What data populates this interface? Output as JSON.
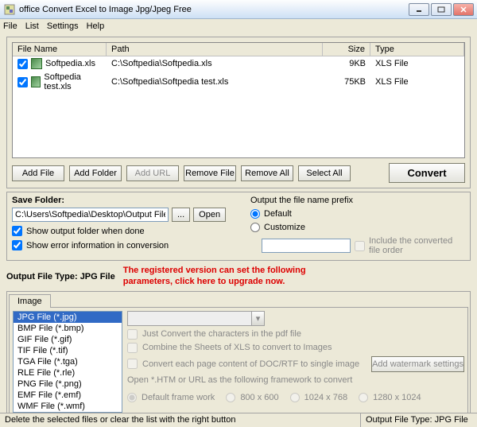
{
  "window": {
    "title": "office Convert Excel to Image Jpg/Jpeg Free"
  },
  "menu": {
    "file": "File",
    "list": "List",
    "settings": "Settings",
    "help": "Help"
  },
  "filelist": {
    "headers": {
      "name": "File Name",
      "path": "Path",
      "size": "Size",
      "type": "Type"
    },
    "rows": [
      {
        "name": "Softpedia.xls",
        "path": "C:\\Softpedia\\Softpedia.xls",
        "size": "9KB",
        "type": "XLS File"
      },
      {
        "name": "Softpedia test.xls",
        "path": "C:\\Softpedia\\Softpedia test.xls",
        "size": "75KB",
        "type": "XLS File"
      }
    ]
  },
  "buttons": {
    "add_file": "Add File",
    "add_folder": "Add Folder",
    "add_url": "Add URL",
    "remove_file": "Remove File",
    "remove_all": "Remove All",
    "select_all": "Select All",
    "convert": "Convert"
  },
  "save": {
    "group": "Save Folder:",
    "path": "C:\\Users\\Softpedia\\Desktop\\Output Files",
    "browse": "...",
    "open": "Open",
    "show_output": "Show output folder when done",
    "show_error": "Show error information in conversion"
  },
  "prefix": {
    "label": "Output the file name prefix",
    "default": "Default",
    "customize": "Customize",
    "include": "Include the converted file order"
  },
  "output_type": {
    "label": "Output File Type:",
    "value": "JPG File"
  },
  "upgrade": "The registered version can set the following parameters, click here to upgrade now.",
  "tab": {
    "image": "Image"
  },
  "formats": [
    "JPG File  (*.jpg)",
    "BMP File  (*.bmp)",
    "GIF File  (*.gif)",
    "TIF File  (*.tif)",
    "TGA File  (*.tga)",
    "RLE File  (*.rle)",
    "PNG File  (*.png)",
    "EMF File  (*.emf)",
    "WMF File  (*.wmf)"
  ],
  "options": {
    "just_convert": "Just Convert the characters in the pdf file",
    "combine": "Combine the Sheets of XLS to convert to Images",
    "each_page": "Convert each page content of DOC/RTF to single image",
    "watermark": "Add watermark settings",
    "framework_label": "Open *.HTM or URL as the following framework to convert",
    "resolutions": {
      "default": "Default frame work",
      "r1": "800 x 600",
      "r2": "1024 x 768",
      "r3": "1280 x 1024"
    }
  },
  "status": {
    "left": "Delete the selected files or clear the list with the right button",
    "right": "Output File Type: JPG File"
  }
}
